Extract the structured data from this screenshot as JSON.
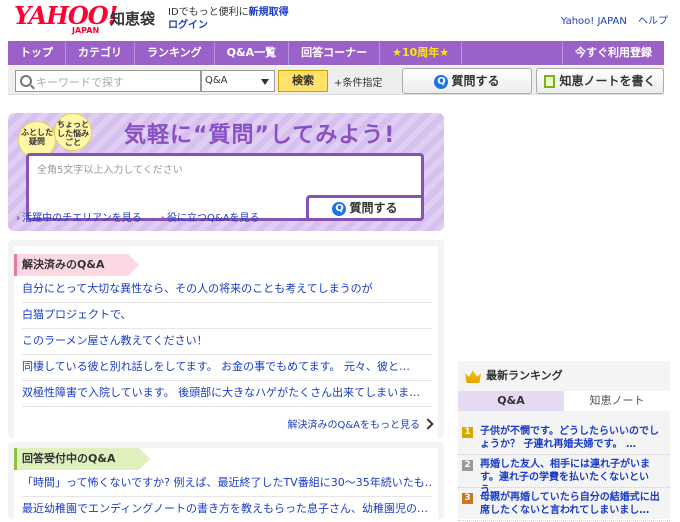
{
  "header": {
    "logo_text": "YAHOO!",
    "logo_sub": "JAPAN",
    "service_name": "知恵袋",
    "login_note": "IDでもっと便利に",
    "register_link": "新規取得",
    "login_link": "ログイン",
    "links": [
      "Yahoo! JAPAN",
      "ヘルプ"
    ]
  },
  "nav": {
    "items": [
      "トップ",
      "カテゴリ",
      "ランキング",
      "Q&A一覧",
      "回答コーナー",
      "★10周年★"
    ],
    "register": "今すぐ利用登録"
  },
  "search": {
    "placeholder": "キーワードで探す",
    "scope": "Q&A",
    "button": "検索",
    "conditions": "条件指定",
    "ask_button": "質問する",
    "note_button": "知恵ノートを書く"
  },
  "hero": {
    "badge1": "ふとした疑問",
    "badge2": "ちょっとした悩みごと",
    "title": "気軽に“質問”してみよう!",
    "input_placeholder": "全角5文字以上入力してください",
    "ask_button": "質問する",
    "link1": "活躍中のチエリアンを見る",
    "link2": "役に立つQ&Aを見る"
  },
  "resolved": {
    "heading": "解決済みのQ&A",
    "items": [
      "自分にとって大切な異性なら、その人の将来のことも考えてしまうのが",
      "白猫プロジェクトで、",
      "このラーメン屋さん教えてください！",
      "同棲している彼と別れ話しをしてます。 お金の事でもめてます。 元々、彼と…",
      "双極性障害で入院しています。 後頭部に大きなハゲがたくさん出来てしまいま…"
    ],
    "more": "解決済みのQ&Aをもっと見る"
  },
  "open": {
    "heading": "回答受付中のQ&A",
    "items": [
      "「時間」って怖くないですか? 例えば、最近終了したTV番組に30〜35年続いたも…",
      "最近幼稚園でエンディングノートの書き方を教えもらった息子さん、幼稚園児の…"
    ]
  },
  "ranking": {
    "heading": "最新ランキング",
    "tabs": [
      "Q&A",
      "知恵ノート"
    ],
    "items": [
      {
        "rank": "1",
        "text": "子供が不憫です。どうしたらいいのでしょうか？ 子連れ再婚夫婦です。 …"
      },
      {
        "rank": "2",
        "text": "再婚した友人、相手には連れ子がいます。連れ子の学費を払いたくないという…"
      },
      {
        "rank": "3",
        "text": "母親が再婚していたら自分の結婚式に出席したくないと言われてしまいまし…"
      }
    ]
  }
}
